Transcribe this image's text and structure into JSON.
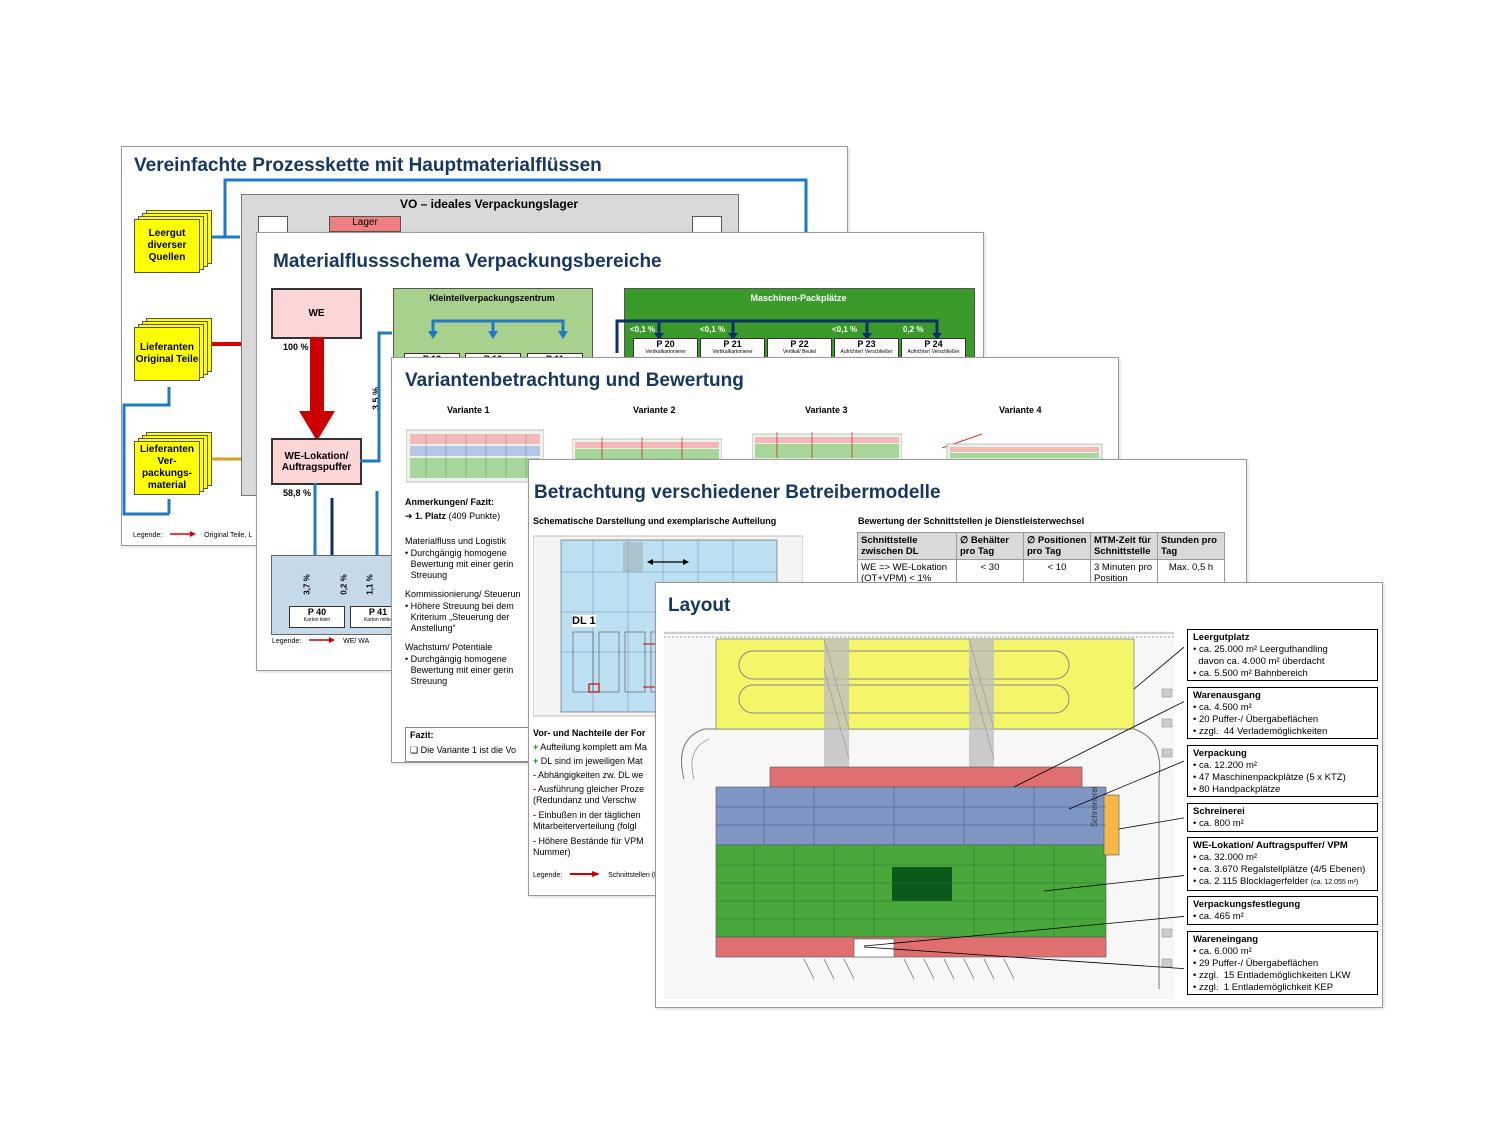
{
  "slide1": {
    "title": "Vereinfachte Prozesskette mit Hauptmaterialflüssen",
    "center_title": "VO – ideales Verpackungslager",
    "lager_label": "Lager",
    "sources": [
      "Leergut diverser Quellen",
      "Lieferanten Original Teile",
      "Lieferanten Ver-packungs-material"
    ],
    "legend_label": "Legende:",
    "legend_item": "Original Teile, L"
  },
  "slide2": {
    "title": "Materialflussschema Verpackungsbereiche",
    "we": "WE",
    "we_pct": "100 %",
    "we_lokation": "WE-Lokation/ Auftragspuffer",
    "we_lokation_pct": "58,8 %",
    "side_pct": "3,5 %",
    "kleinteil_title": "Kleinteilverpackungszentrum",
    "kleinteil_boxes": [
      "P 12",
      "P 10",
      "P 11"
    ],
    "maschinen_title": "Maschinen-Packplätze",
    "maschinen_pcts": [
      "<0,1 %",
      "<0,1 %",
      "<0,1 %",
      "0,2 %"
    ],
    "maschinen_boxes": [
      {
        "label": "P 20",
        "sub": "Vertikalkartonierer"
      },
      {
        "label": "P 21",
        "sub": "Vertikalkartonierer"
      },
      {
        "label": "P 22",
        "sub": "Vertikal/ Beutel"
      },
      {
        "label": "P 23",
        "sub": "Aufrichter/ Verschließer"
      },
      {
        "label": "P 24",
        "sub": "Aufrichter/ Verschließer"
      }
    ],
    "bottom_pcts": [
      "3,7 %",
      "0,2 %",
      "1,1 %"
    ],
    "bottom_boxes": [
      {
        "label": "P 40",
        "sub": "Karton klein"
      },
      {
        "label": "P 41",
        "sub": "Karton mittel"
      }
    ],
    "legend_label": "Legende:",
    "legend_item": "WE/ WA"
  },
  "slide3": {
    "title": "Variantenbetrachtung und Bewertung",
    "variants": [
      "Variante 1",
      "Variante 2",
      "Variante 3",
      "Variante 4"
    ],
    "anmerkungen": "Anmerkungen/ Fazit:",
    "platz": "1. Platz",
    "punkte": "(409 Punkte)",
    "sec1_title": "Materialfluss und Logistik",
    "sec1_text": "Durchgängig homogene Bewertung mit einer gerin Streuung",
    "sec2_title": "Kommissionierung/ Steuerun",
    "sec2_text": "Höhere Streuung bei dem Kriterium „Steuerung der Anstellung“",
    "sec3_title": "Wachstum/ Potentiale",
    "sec3_text": "Durchgängig homogene Bewertung mit einer gerin Streuung",
    "fazit_title": "Fazit:",
    "fazit_text": "Die Variante 1 ist die Vo"
  },
  "slide4": {
    "title": "Betrachtung verschiedener Betreibermodelle",
    "left_heading": "Schematische Darstellung und exemplarische Aufteilung",
    "right_heading": "Bewertung der Schnittstellen je Dienstleisterwechsel",
    "dl_label": "DL 1",
    "table_headers": [
      "Schnittstelle zwischen DL",
      "∅ Behälter pro Tag",
      "∅ Positionen pro Tag",
      "MTM-Zeit für Schnittstelle",
      "Stunden pro Tag"
    ],
    "table_row": [
      "WE => WE-Lokation (OT+VPM) < 1%",
      "< 30",
      "< 10",
      "3 Minuten pro Position",
      "Max. 0,5 h"
    ],
    "vn_title": "Vor- und Nachteile der For",
    "vn_items": [
      {
        "sign": "+",
        "text": "Aufteilung komplett am Ma"
      },
      {
        "sign": "+",
        "text": "DL sind im jeweiligen Mat"
      },
      {
        "sign": "-",
        "text": "Abhängigkeiten zw. DL we"
      },
      {
        "sign": "-",
        "text": "Ausführung gleicher Proze (Redundanz und Verschw"
      },
      {
        "sign": "-",
        "text": "Einbußen in der täglichen Mitarbeiterverteilung (folgl"
      },
      {
        "sign": "-",
        "text": "Höhere Bestände für VPM Nummer)"
      }
    ],
    "legend_label": "Legende:",
    "legend_item": "Schnittstellen (F"
  },
  "slide5": {
    "title": "Layout",
    "schreinerei_vertical": "Schreinerei",
    "boxes": [
      {
        "heading": "Leergutplatz",
        "lines": [
          "• ca. 25.000 m² Leerguthandling",
          "  davon ca. 4.000 m² überdacht",
          "• ca. 5.500 m² Bahnbereich"
        ]
      },
      {
        "heading": "Warenausgang",
        "lines": [
          "• ca. 4.500 m²",
          "• 20 Puffer-/ Übergabeflächen",
          "• zzgl.  44 Verlademöglichkeiten"
        ]
      },
      {
        "heading": "Verpackung",
        "lines": [
          "• ca. 12.200 m²",
          "• 47 Maschinenpackplätze (5 x KTZ)",
          "• 80 Handpackplätze"
        ]
      },
      {
        "heading": "Schreinerei",
        "lines": [
          "• ca. 800 m²"
        ]
      },
      {
        "heading": "WE-Lokation/ Auftragspuffer/ VPM",
        "lines": [
          "• ca. 32.000 m²",
          "• ca. 3.670 Regalstellplätze (4/5 Ebenen)",
          "• ca. 2.115 Blocklagerfelder"
        ],
        "note": "(ca. 12.055 m²)"
      },
      {
        "heading": "Verpackungsfestlegung",
        "lines": [
          "• ca. 465 m²"
        ]
      },
      {
        "heading": "Wareneingang",
        "lines": [
          "• ca. 6.000 m²",
          "• 29 Puffer-/ Übergabeflächen",
          "• zzgl.  15 Entlademöglichkeiten LKW",
          "• zzgl.  1 Entlademöglichkeit KEP"
        ]
      }
    ]
  },
  "colors": {
    "title_blue": "#17375e",
    "yellow": "#ffff00",
    "pink": "#fcd5d5",
    "flow_blue": "#1f78c8",
    "flow_red": "#cc0000",
    "flow_navy": "#0f2f6b",
    "light_green": "#a9d18e",
    "dark_green": "#3a9b2a",
    "layout_yellow": "#f5f56a",
    "layout_red": "#e07070",
    "layout_blue": "#7f96c4",
    "layout_green": "#49a83c"
  }
}
